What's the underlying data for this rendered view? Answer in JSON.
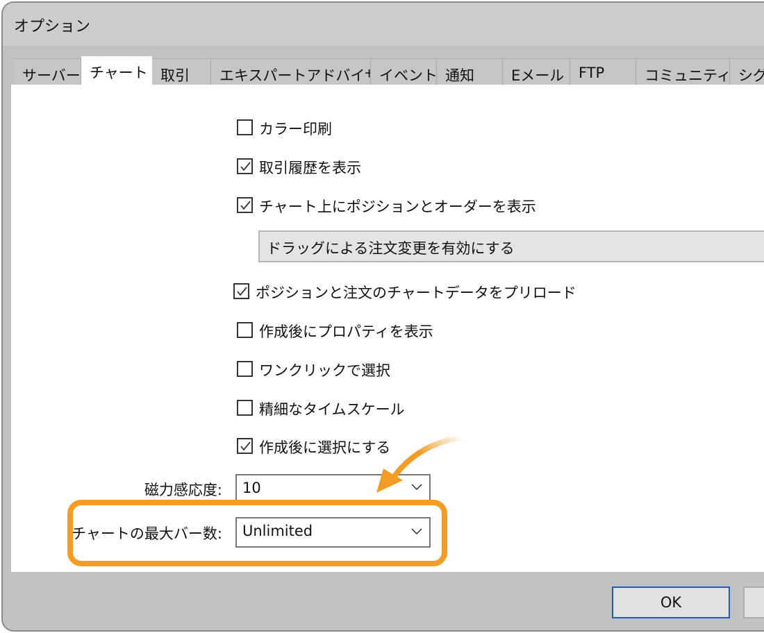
{
  "window": {
    "title": "オプション"
  },
  "tabs": [
    "サーバー",
    "チャート",
    "取引",
    "エキスパートアドバイザ",
    "イベント",
    "通知",
    "Eメール",
    "FTP",
    "コミュニティー",
    "シグ"
  ],
  "selected_tab": "チャート",
  "options": [
    {
      "label": "カラー印刷",
      "checked": false
    },
    {
      "label": "取引履歴を表示",
      "checked": true
    },
    {
      "label": "チャート上にポジションとオーダーを表示",
      "checked": true
    },
    {
      "label": "ポジションと注文のチャートデータをプリロード",
      "checked": true
    },
    {
      "label": "作成後にプロパティを表示",
      "checked": false
    },
    {
      "label": "ワンクリックで選択",
      "checked": false
    },
    {
      "label": "精細なタイムスケール",
      "checked": false
    },
    {
      "label": "作成後に選択にする",
      "checked": true
    }
  ],
  "drag_option": {
    "label": "ドラッグによる注文変更を有効にする"
  },
  "magnet": {
    "label": "磁力感応度:",
    "value": "10"
  },
  "max_bars": {
    "label": "チャートの最大バー数:",
    "value": "Unlimited"
  },
  "buttons": {
    "ok": "OK"
  },
  "colors": {
    "highlight": "#f39c26",
    "ok_border": "#1a5fb4"
  }
}
